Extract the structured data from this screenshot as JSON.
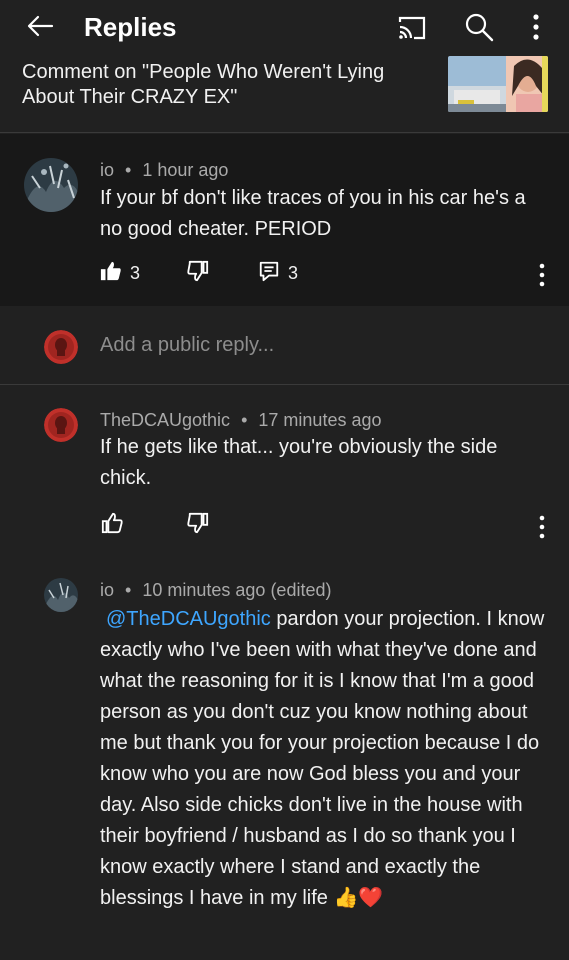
{
  "header": {
    "title": "Replies",
    "icons": [
      "back-arrow-icon",
      "cast-icon",
      "search-icon",
      "more-vertical-icon"
    ]
  },
  "context": {
    "text": "Comment on \"People Who Weren't Lying About Their CRAZY EX\""
  },
  "parent_comment": {
    "author": "io",
    "time": "1 hour ago",
    "body": "If your bf don't like traces of you in his car he's a no good cheater. PERIOD",
    "likes": "3",
    "replies": "3"
  },
  "reply_box": {
    "placeholder": "Add a public reply..."
  },
  "replies": [
    {
      "author": "TheDCAUgothic",
      "time": "17 minutes ago",
      "body": "If he gets like that... you're obviously the side chick."
    },
    {
      "author": "io",
      "time": "10 minutes ago (edited)",
      "mention": "@TheDCAUgothic",
      "body": " pardon your projection. I know exactly who I've been with what they've done and what the reasoning for it is I know that I'm a good person as you don't cuz you know nothing about me but thank you for your projection because I do know who you are now God bless you and your day. Also side chicks don't live in the house with their boyfriend / husband as I do so thank you I know exactly where I stand and exactly the blessings I have in my life",
      "emoji": "👍❤️"
    }
  ],
  "separator": "•"
}
